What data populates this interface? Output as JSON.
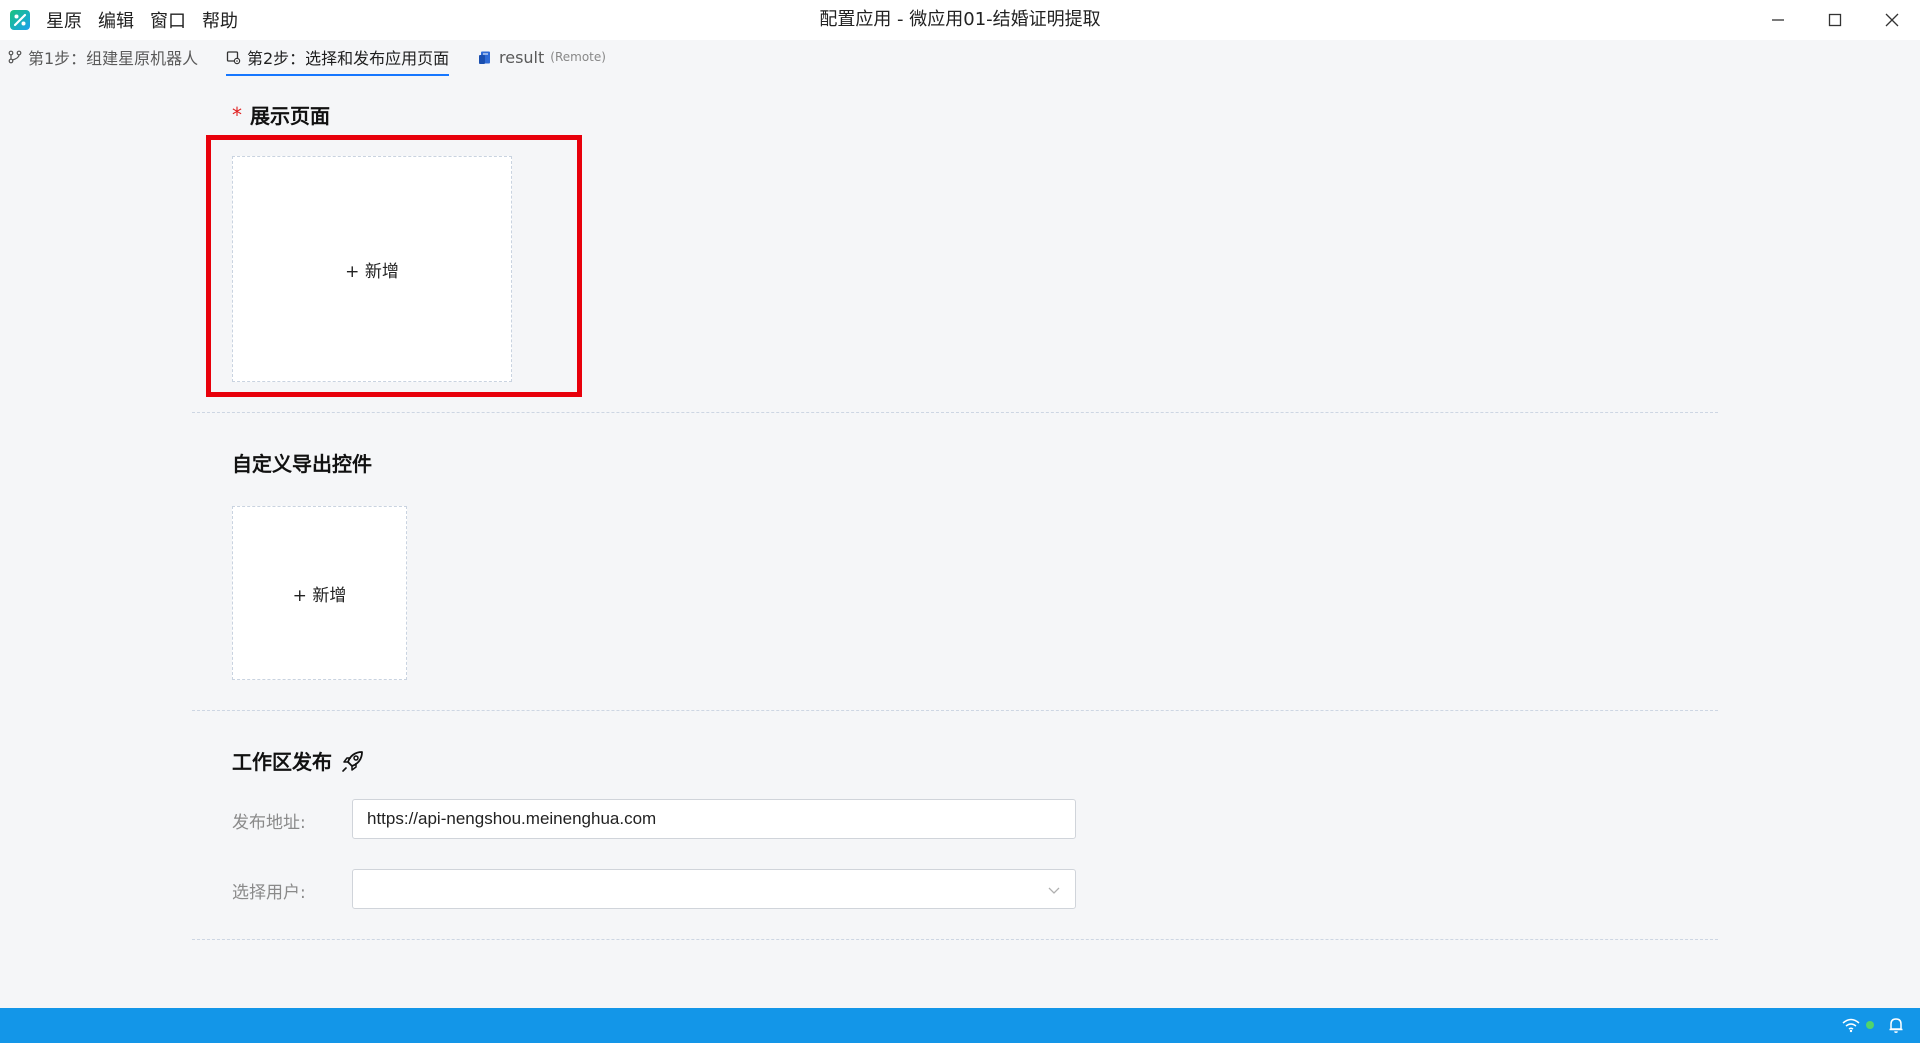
{
  "window": {
    "title": "配置应用 - 微应用01-结婚证明提取",
    "menu": [
      "星原",
      "编辑",
      "窗口",
      "帮助"
    ]
  },
  "tabs": [
    {
      "label": "第1步：组建星原机器人",
      "icon": "branch-icon",
      "active": false
    },
    {
      "label": "第2步：选择和发布应用页面",
      "icon": "page-settings-icon",
      "active": true
    },
    {
      "label": "result",
      "suffix": "(Remote)",
      "icon": "remote-file-icon",
      "active": false
    }
  ],
  "display_page": {
    "required_mark": "*",
    "title": "展示页面",
    "add_label": "+ 新增"
  },
  "custom_export": {
    "title": "自定义导出控件",
    "add_label": "+ 新增"
  },
  "workspace_publish": {
    "title": "工作区发布",
    "title_icon": "rocket-icon",
    "address_label": "发布地址:",
    "address_value": "https://api-nengshou.meinenghua.com",
    "user_label": "选择用户:",
    "user_value": ""
  },
  "colors": {
    "accent": "#1677ff",
    "highlight": "#e8000b",
    "statusbar": "#1396e8"
  },
  "statusbar": {
    "icons": [
      "wifi-icon",
      "online-dot-icon",
      "bell-icon"
    ]
  }
}
